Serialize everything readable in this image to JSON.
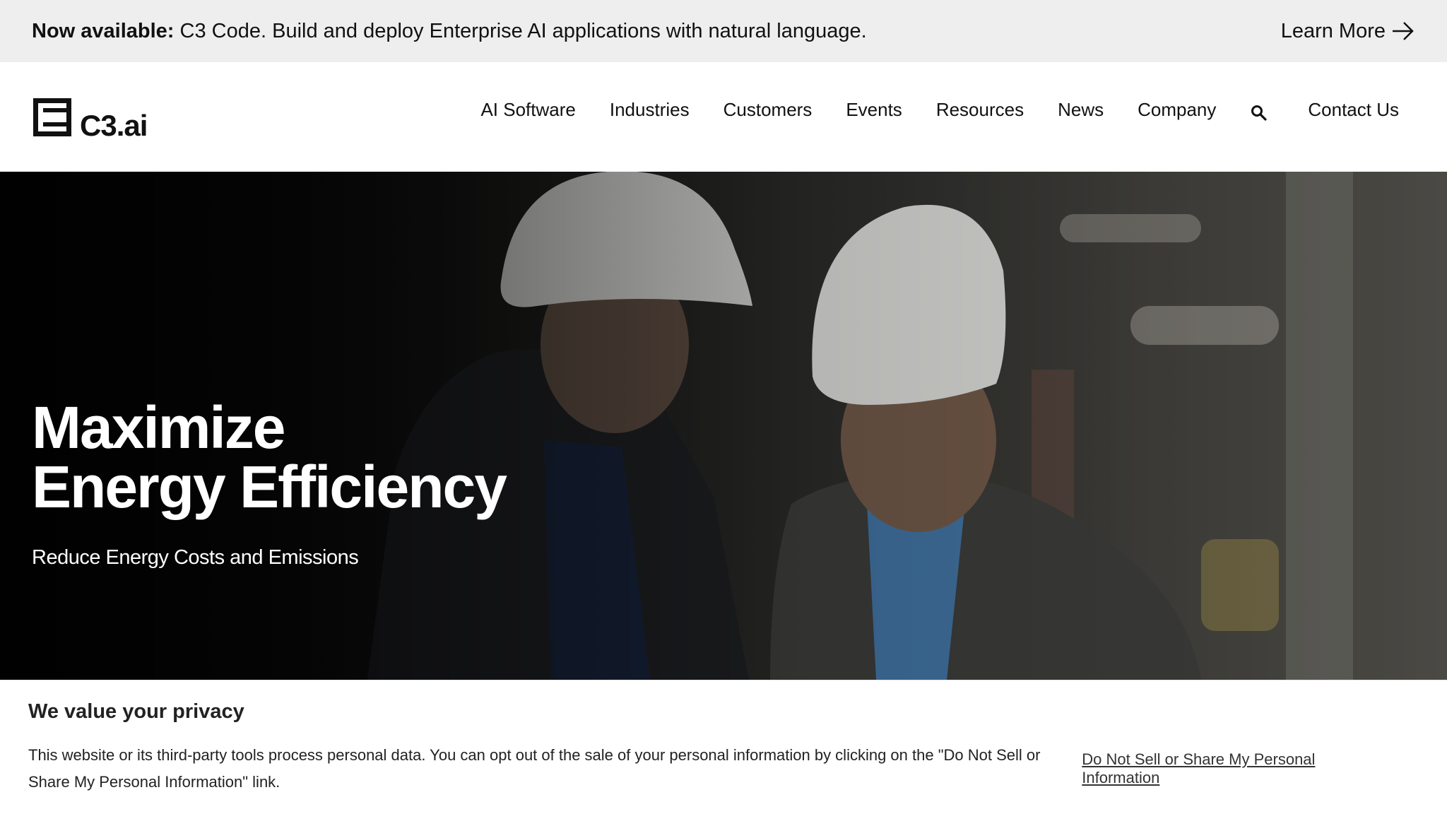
{
  "announcement": {
    "lead": "Now available:",
    "text": " C3 Code. Build and deploy Enterprise AI applications with natural language.",
    "cta": "Learn More"
  },
  "header": {
    "logo_text": "C3.ai",
    "nav": [
      "AI Software",
      "Industries",
      "Customers",
      "Events",
      "Resources",
      "News",
      "Company"
    ],
    "search_icon": "search-icon",
    "contact": "Contact Us"
  },
  "hero": {
    "title_line1": "Maximize",
    "title_line2": "Energy Efficiency",
    "subtitle": "Reduce Energy Costs and Emissions"
  },
  "privacy": {
    "title": "We value your privacy",
    "text": "This website or its third-party tools process personal data. You can opt out of the sale of your personal information by clicking on the \"Do Not Sell or Share My Personal Information\" link.",
    "link": "Do Not Sell or Share My Personal Information"
  }
}
